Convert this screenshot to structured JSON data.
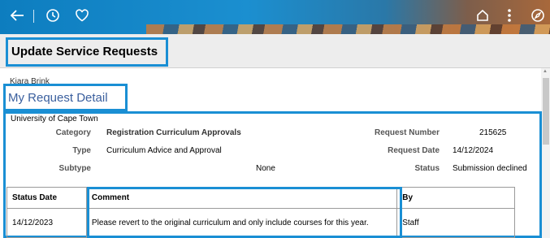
{
  "header": {
    "icons": [
      "back-arrow-icon",
      "history-icon",
      "favorite-heart-icon",
      "home-icon",
      "more-options-icon",
      "navigator-compass-icon"
    ]
  },
  "page": {
    "title": "Update Service Requests"
  },
  "user": {
    "name": "Kiara Brink"
  },
  "section": {
    "title": "My Request Detail"
  },
  "institution": "University of Cape Town",
  "details": {
    "category_label": "Category",
    "category_value": "Registration Curriculum Approvals",
    "type_label": "Type",
    "type_value": "Curriculum Advice and Approval",
    "subtype_label": "Subtype",
    "subtype_value": "None",
    "request_number_label": "Request Number",
    "request_number_value": "215625",
    "request_date_label": "Request Date",
    "request_date_value": "14/12/2024",
    "status_label": "Status",
    "status_value": "Submission declined"
  },
  "table": {
    "headers": [
      "Status Date",
      "Comment",
      "By"
    ],
    "rows": [
      {
        "date": "14/12/2023",
        "comment": "Please revert to the original curriculum and only include courses for this year.",
        "by": "Staff"
      }
    ]
  },
  "colors": {
    "accent": "#1a8fd4",
    "section_title": "#3a5f9e"
  }
}
